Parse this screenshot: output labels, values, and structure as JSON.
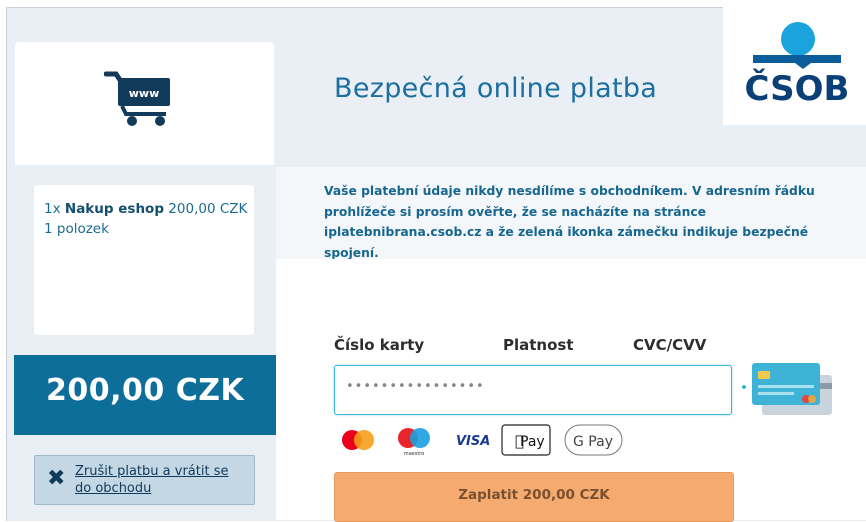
{
  "header": {
    "title": "Bezpečná online platba",
    "logo_text": "ČSOB"
  },
  "merchant": {
    "cart_text": "www"
  },
  "order": {
    "quantity": "1x",
    "item_name": "Nakup eshop",
    "item_price": "200,00 CZK",
    "items_count": "1 polozek",
    "total": "200,00 CZK"
  },
  "actions": {
    "cancel_label": "Zrušit platbu a vrátit se do obchodu",
    "pay_label": "Zaplatit 200,00 CZK"
  },
  "notice": {
    "text": "Vaše platební údaje nikdy nesdílíme s obchodníkem. V adresním řádku prohlížeče si prosím ověřte, že se nacházíte na stránce iplatebnibrana.csob.cz a že zelená ikonka zámečku indikuje bezpečné spojení."
  },
  "form": {
    "card_number_label": "Číslo karty",
    "expiry_label": "Platnost",
    "cvc_label": "CVC/CVV",
    "card_number_placeholder": "••••••••••••••••"
  },
  "payment_methods": {
    "visa": "VISA",
    "apple_pay": "Pay",
    "google_pay": "G Pay",
    "maestro": "maestro"
  },
  "colors": {
    "brand_blue": "#0d6e99",
    "title_blue": "#1d6fa0",
    "pay_button": "#f5ab6f",
    "input_focus": "#3cb6d8"
  }
}
